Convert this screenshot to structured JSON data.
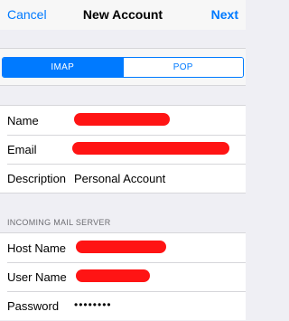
{
  "navbar": {
    "cancel_label": "Cancel",
    "title": "New Account",
    "next_label": "Next"
  },
  "account_type": {
    "options": [
      "IMAP",
      "POP"
    ],
    "selected": "IMAP"
  },
  "account": {
    "name_label": "Name",
    "email_label": "Email",
    "description_label": "Description",
    "description_value": "Personal Account"
  },
  "incoming": {
    "header": "INCOMING MAIL SERVER",
    "host_label": "Host Name",
    "user_label": "User Name",
    "password_label": "Password",
    "password_value": "••••••••"
  },
  "colors": {
    "accent": "#007aff",
    "background": "#efeff4",
    "redaction": "#ff1414"
  }
}
